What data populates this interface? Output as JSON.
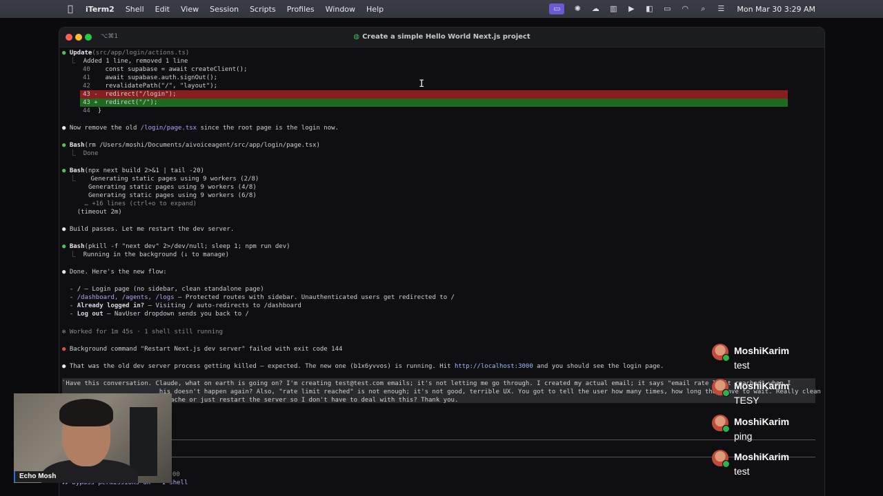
{
  "menubar": {
    "apple_icon": "apple-icon",
    "app_name": "iTerm2",
    "menus": [
      "Shell",
      "Edit",
      "View",
      "Session",
      "Scripts",
      "Profiles",
      "Window",
      "Help"
    ],
    "clock": "Mon Mar 30  3:29 AM"
  },
  "window": {
    "shortcut": "⌥⌘1",
    "title": "Create a simple Hello World Next.js project"
  },
  "terminal": {
    "update_tool": "Update",
    "update_path": "(src/app/login/actions.ts)",
    "update_summary": "Added 1 line, removed 1 line",
    "code": [
      {
        "num": "40",
        "text": "const supabase = await createClient();"
      },
      {
        "num": "41",
        "text": "await supabase.auth.signOut();"
      },
      {
        "num": "42",
        "text": "revalidatePath(\"/\", \"layout\");"
      },
      {
        "num": "43 -",
        "text": "redirect(\"/login\");"
      },
      {
        "num": "43 +",
        "text": "redirect(\"/\");"
      },
      {
        "num": "44",
        "text": "}"
      }
    ],
    "msg_remove_a": "Now remove the old ",
    "msg_remove_path": "/login/page.tsx",
    "msg_remove_b": " since the root page is the login now.",
    "bash1_tool": "Bash",
    "bash1_cmd": "(rm /Users/moshi/Documents/aivoiceagent/src/app/login/page.tsx)",
    "bash1_out": "Done",
    "bash2_tool": "Bash",
    "bash2_cmd": "(npx next build 2>&1 | tail -20)",
    "bash2_out": [
      "Generating static pages using 9 workers (2/8)",
      "Generating static pages using 9 workers (4/8)",
      "Generating static pages using 9 workers (6/8)"
    ],
    "bash2_more": "… +16 lines (ctrl+o to expand)",
    "bash2_timeout": "(timeout 2m)",
    "msg_build": "Build passes. Let me restart the dev server.",
    "bash3_tool": "Bash",
    "bash3_cmd": "(pkill -f \"next dev\" 2>/dev/null; sleep 1; npm run dev)",
    "bash3_out": "Running in the background (↓ to manage)",
    "msg_done": "Done. Here's the new flow:",
    "flow": [
      {
        "route": "/",
        "desc": " — Login page (no sidebar, clean standalone page)"
      },
      {
        "route": "/dashboard, /agents, /logs",
        "desc": " — Protected routes with sidebar. Unauthenticated users get redirected to /"
      },
      {
        "route": "Already logged in?",
        "desc": " — Visiting / auto-redirects to /dashboard"
      },
      {
        "route": "Log out",
        "desc": " — NavUser dropdown sends you back to /"
      }
    ],
    "worked": "✻ Worked for 1m 45s · 1 shell still running",
    "bg_failed": "Background command \"Restart Next.js dev server\" failed with exit code 144",
    "msg_final_a": "That was the old dev server process getting killed — expected. The new one (b1x6yvvos) is running. Hit ",
    "msg_final_link": "http://localhost:3000",
    "msg_final_b": " and you should see the login page.",
    "prompt_lines": [
      "`Have this conversation. Claude, what on earth is going on? I'm creating test@test.com emails; it's not letting me go through. I created my actual email; it says \"email rate limit reached\" when I",
      "                          his doesn't happen again? Also, \"rate limit reached\" is not enough; it's not good, terrible UX. You got to tell the user how many times, how long they have to wait. Really clean",
      "                          e cache or just restart the server so I don't have to deal with this? Thank you."
    ],
    "status_time": "00",
    "status_line": "⏵⏵ bypass permissions on · 1 shell"
  },
  "webcam": {
    "name": "Echo Mosh"
  },
  "chat": [
    {
      "user": "MoshiKarim",
      "text": "test"
    },
    {
      "user": "MoshiKarim",
      "text": "TESY"
    },
    {
      "user": "MoshiKarim",
      "text": "ping"
    },
    {
      "user": "MoshiKarim",
      "text": "test"
    }
  ]
}
